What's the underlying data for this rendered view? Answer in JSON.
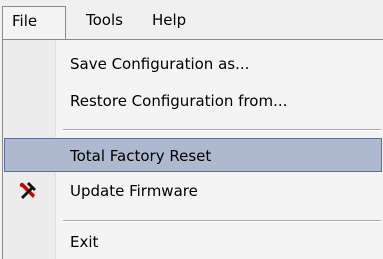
{
  "menubar": {
    "items": [
      {
        "label": "File",
        "active": true
      },
      {
        "label": "Tools",
        "active": false
      },
      {
        "label": "Help",
        "active": false
      }
    ]
  },
  "file_menu": {
    "items": [
      {
        "label": "Save Configuration as...",
        "icon": null,
        "highlighted": false
      },
      {
        "label": "Restore Configuration from...",
        "icon": null,
        "highlighted": false
      },
      {
        "label": "Total Factory Reset",
        "icon": null,
        "highlighted": true
      },
      {
        "label": "Update Firmware",
        "icon": "hammer-wrench-icon",
        "highlighted": false
      },
      {
        "label": "Exit",
        "icon": null,
        "highlighted": false
      }
    ]
  },
  "colors": {
    "highlight_fill": "#aeb9cf",
    "highlight_border": "#5d6f98",
    "menu_background": "#f4f4f4",
    "icon_red": "#d10000",
    "icon_black": "#111111"
  }
}
